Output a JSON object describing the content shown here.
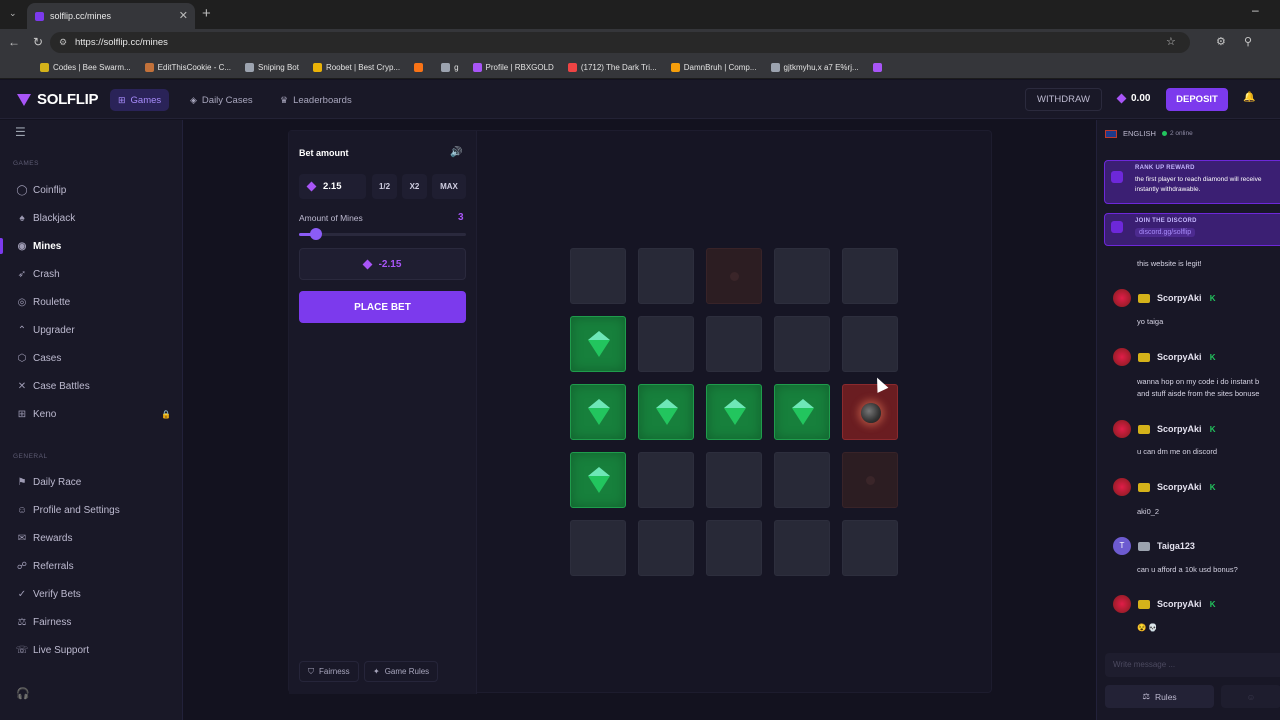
{
  "browser": {
    "tab_title": "solflip.cc/mines",
    "url": "https://solflip.cc/mines",
    "bookmarks": [
      {
        "label": "Codes | Bee Swarm...",
        "color": "#d4b21a"
      },
      {
        "label": "EditThisCookie - C...",
        "color": "#c2713a"
      },
      {
        "label": "Sniping Bot",
        "color": "#9ca3af"
      },
      {
        "label": "Roobet | Best Cryp...",
        "color": "#eab308"
      },
      {
        "label": "",
        "color": "#f97316"
      },
      {
        "label": "g",
        "color": "#9ca3af"
      },
      {
        "label": "Profile | RBXGOLD",
        "color": "#a855f7"
      },
      {
        "label": "(1712) The Dark Tri...",
        "color": "#ef4444"
      },
      {
        "label": "DamnBruh | Comp...",
        "color": "#f59e0b"
      },
      {
        "label": "gjtkmyhu,x a7 E%rj...",
        "color": "#9ca3af"
      },
      {
        "label": "",
        "color": "#a855f7"
      }
    ]
  },
  "header": {
    "logo": "SOLFLIP",
    "nav": [
      {
        "label": "Games",
        "icon": "gamepad-icon",
        "active": true
      },
      {
        "label": "Daily Cases",
        "icon": "box-icon",
        "active": false
      },
      {
        "label": "Leaderboards",
        "icon": "trophy-icon",
        "active": false
      }
    ],
    "withdraw": "WITHDRAW",
    "balance": "0.00",
    "deposit": "DEPOSIT"
  },
  "sidebar": {
    "games_heading": "GAMES",
    "games": [
      {
        "label": "Coinflip",
        "icon": "coin-icon"
      },
      {
        "label": "Blackjack",
        "icon": "cards-icon"
      },
      {
        "label": "Mines",
        "icon": "mines-icon",
        "active": true
      },
      {
        "label": "Crash",
        "icon": "rocket-icon"
      },
      {
        "label": "Roulette",
        "icon": "roulette-icon"
      },
      {
        "label": "Upgrader",
        "icon": "arrow-up-icon"
      },
      {
        "label": "Cases",
        "icon": "case-icon"
      },
      {
        "label": "Case Battles",
        "icon": "swords-icon"
      },
      {
        "label": "Keno",
        "icon": "grid-icon",
        "locked": true
      }
    ],
    "general_heading": "GENERAL",
    "general": [
      {
        "label": "Daily Race",
        "icon": "flag-icon"
      },
      {
        "label": "Profile and Settings",
        "icon": "user-icon"
      },
      {
        "label": "Rewards",
        "icon": "gift-icon"
      },
      {
        "label": "Referrals",
        "icon": "users-icon"
      },
      {
        "label": "Verify Bets",
        "icon": "check-icon"
      },
      {
        "label": "Fairness",
        "icon": "scale-icon"
      },
      {
        "label": "Live Support",
        "icon": "chat-icon"
      }
    ]
  },
  "game": {
    "bet_label": "Bet amount",
    "bet_value": "2.15",
    "half": "1/2",
    "double": "X2",
    "max": "MAX",
    "mines_label": "Amount of Mines",
    "mines_count": "3",
    "mines_slider_fraction": 0.1,
    "profit": "-2.15",
    "place_bet": "PLACE BET",
    "fairness": "Fairness",
    "game_rules": "Game Rules",
    "grid": [
      [
        "empty",
        "empty",
        "faded",
        "empty",
        "empty"
      ],
      [
        "gem",
        "empty",
        "empty",
        "empty",
        "empty"
      ],
      [
        "gem",
        "gem",
        "gem",
        "gem",
        "mine"
      ],
      [
        "gem",
        "empty",
        "empty",
        "empty",
        "faded"
      ],
      [
        "empty",
        "empty",
        "empty",
        "empty",
        "empty"
      ]
    ]
  },
  "chat": {
    "language": "ENGLISH",
    "online": "2 online",
    "promo1_title": "RANK UP REWARD",
    "promo1_body": "the first player to reach diamond will receive\ninstantly withdrawable.",
    "promo2_title": "JOIN THE DISCORD",
    "promo2_link": "discord.gg/solflip",
    "messages": [
      {
        "user": "",
        "text": "this website is legit!"
      },
      {
        "user": "ScorpyAki",
        "rank": "K",
        "text": "yo taiga"
      },
      {
        "user": "ScorpyAki",
        "rank": "K",
        "text": "wanna hop on my code i do instant b\nand stuff aisde from the sites bonuse"
      },
      {
        "user": "ScorpyAki",
        "rank": "K",
        "text": "u can dm me on discord"
      },
      {
        "user": "ScorpyAki",
        "rank": "K",
        "text": "aki0_2"
      },
      {
        "user": "Taiga123",
        "rank": "",
        "avatar_letter": "T",
        "text": "can u afford  a 10k usd bonus?"
      },
      {
        "user": "ScorpyAki",
        "rank": "K",
        "text": "😵 💀"
      }
    ],
    "input_placeholder": "Write message ...",
    "rules": "Rules"
  }
}
